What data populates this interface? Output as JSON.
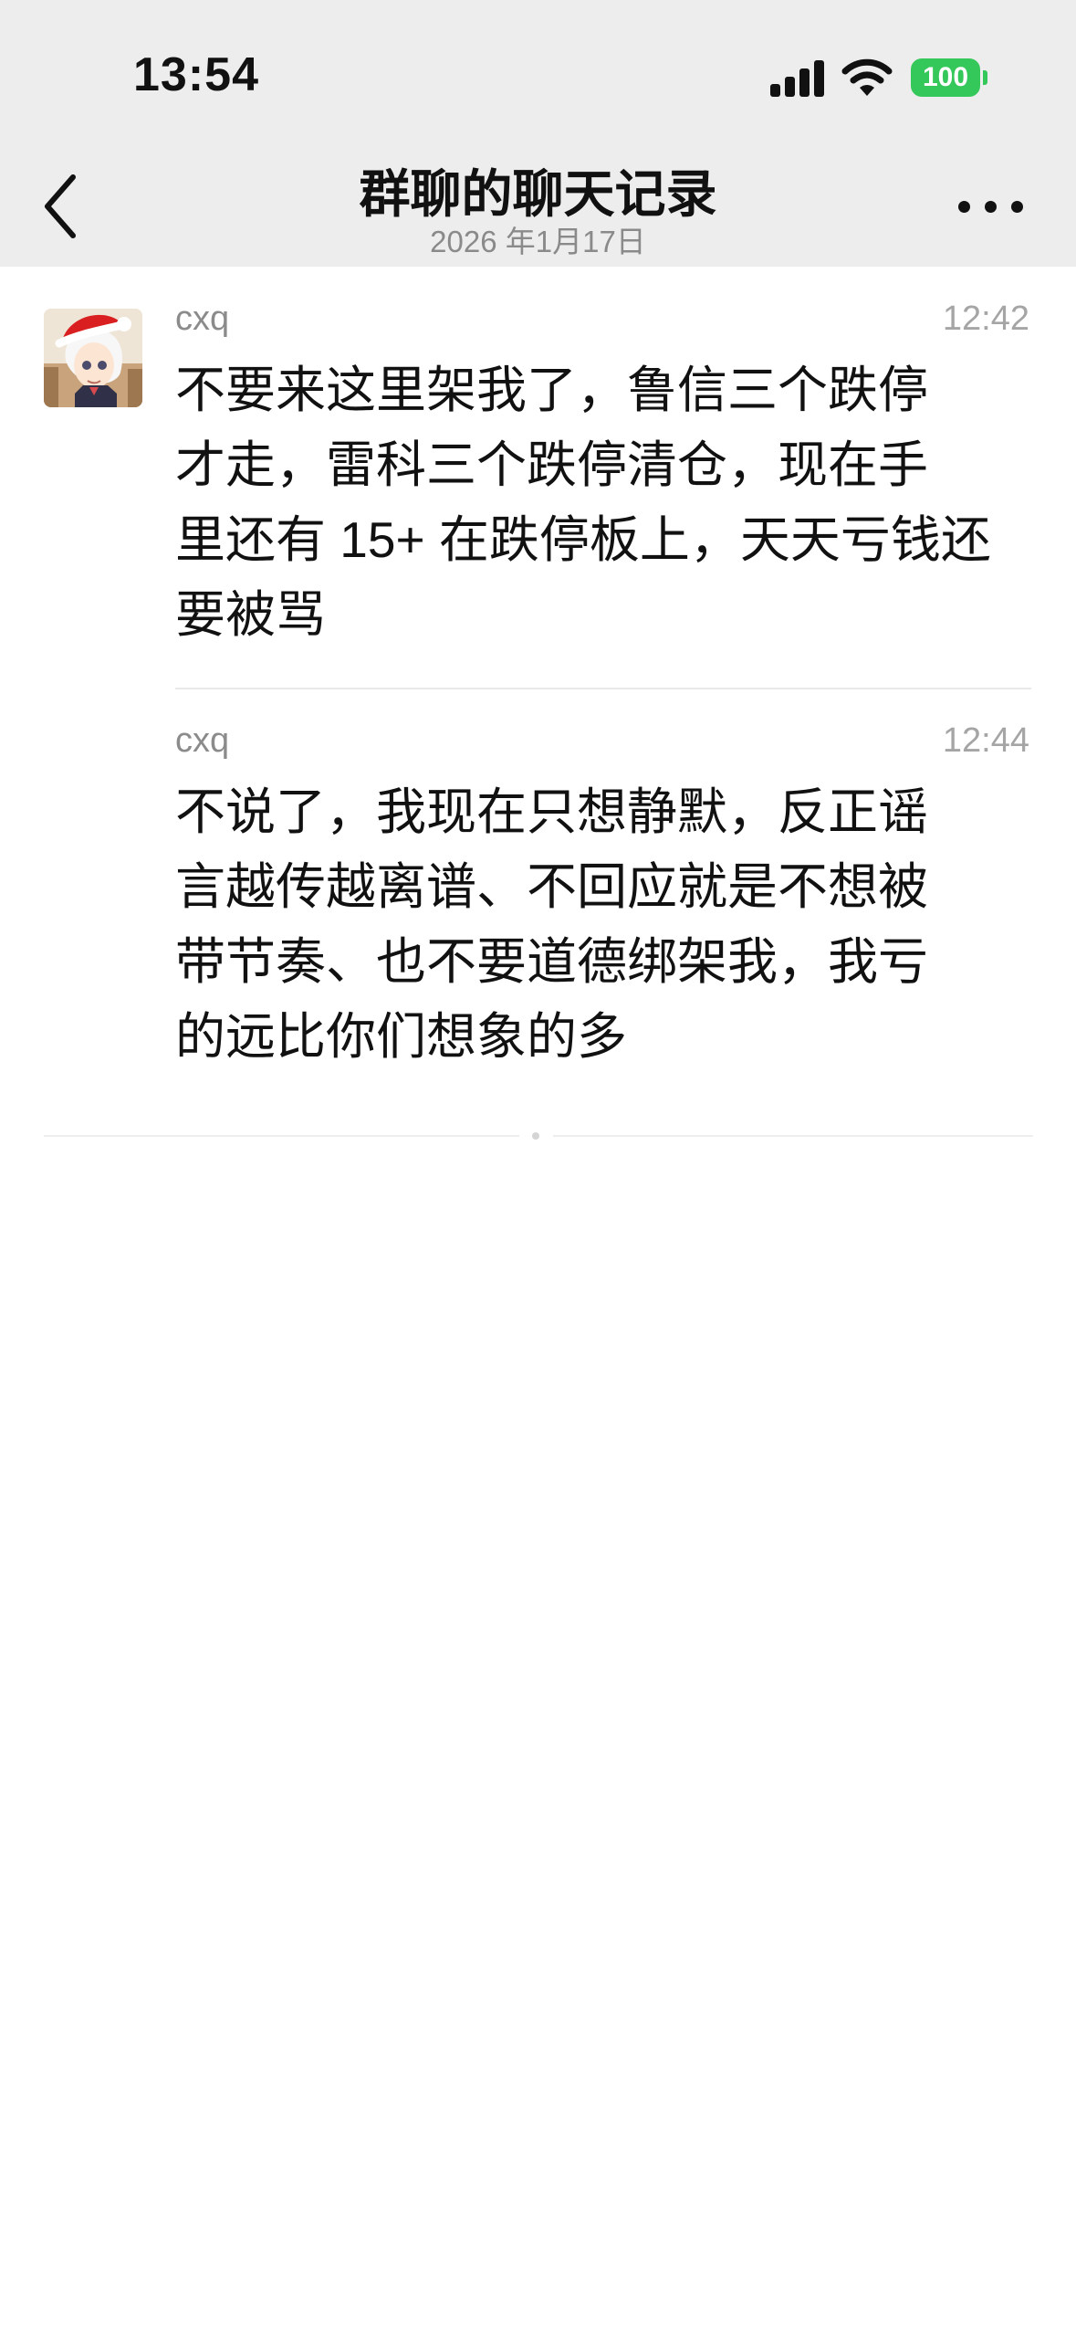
{
  "status_bar": {
    "time": "13:54",
    "battery": "100",
    "signal_icon": "cellular-signal-icon",
    "wifi_icon": "wifi-icon"
  },
  "nav": {
    "title": "群聊的聊天记录",
    "date": "2026 年1月17日",
    "back_icon": "chevron-left-icon",
    "more_icon": "more-dots-icon"
  },
  "messages": [
    {
      "sender": "cxq",
      "time": "12:42",
      "text": "不要来这里架我了，鲁信三个跌停\n才走，雷科三个跌停清仓，现在手\n里还有 15+ 在跌停板上，天天亏钱还\n要被骂"
    },
    {
      "sender": "cxq",
      "time": "12:44",
      "text": "不说了，我现在只想静默，反正谣\n言越传越离谱、不回应就是不想被\n带节奏、也不要道德绑架我，我亏\n的远比你们想象的多"
    }
  ],
  "colors": {
    "header_bg": "#ededed",
    "battery_green": "#34c759",
    "secondary_text": "#8b8b8b"
  }
}
